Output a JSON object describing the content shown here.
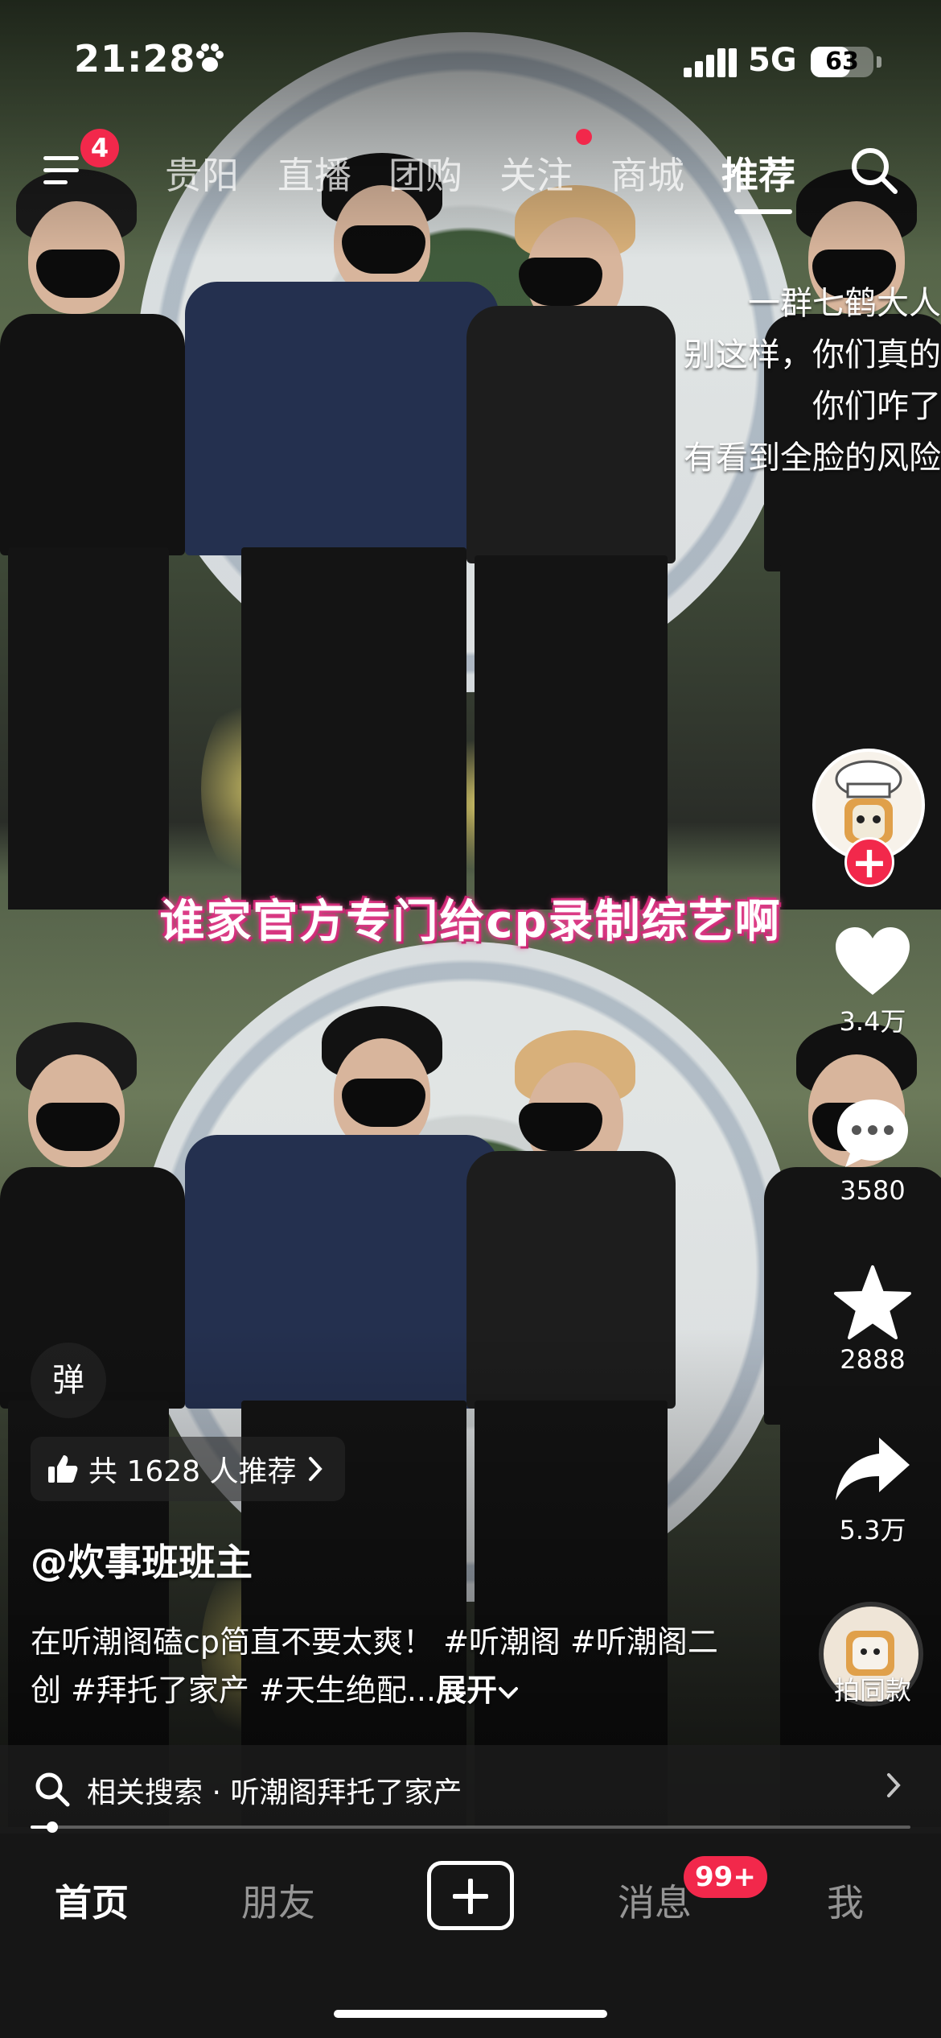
{
  "status_bar": {
    "time": "21:28",
    "network": "5G",
    "battery": "63",
    "battery_level": 0.63
  },
  "top_nav": {
    "menu_badge": "4",
    "tabs": [
      "贵阳",
      "直播",
      "团购",
      "关注",
      "商城",
      "推荐"
    ],
    "active_tab": "推荐"
  },
  "video": {
    "subtitle": "谁家官方专门给cp录制综艺啊",
    "overlay_lines": [
      "一群七鹤大人",
      "别这样，你们真的",
      "你们咋了",
      "有看到全脸的风险"
    ]
  },
  "actions": {
    "like_count": "3.4万",
    "comment_count": "3580",
    "favorite_count": "2888",
    "share_count": "5.3万",
    "sound_label": "拍同款"
  },
  "info": {
    "danmu_label": "弹",
    "recommend_text": "共 1628 人推荐",
    "author": "@炊事班班主",
    "caption": "在听潮阁磕cp简直不要太爽！ #听潮阁 #听潮阁二创 #拜托了家产 #天生绝配...",
    "caption_more": "展开"
  },
  "related_search": {
    "prefix": "相关搜索",
    "separator": "·",
    "query": "听潮阁拜托了家产"
  },
  "progress": 0.025,
  "bottom_tabs": {
    "home": "首页",
    "friends": "朋友",
    "messages": "消息",
    "messages_badge": "99+",
    "me": "我"
  },
  "colors": {
    "accent": "#f2284b",
    "subtitle_glow": "#e0448c"
  }
}
